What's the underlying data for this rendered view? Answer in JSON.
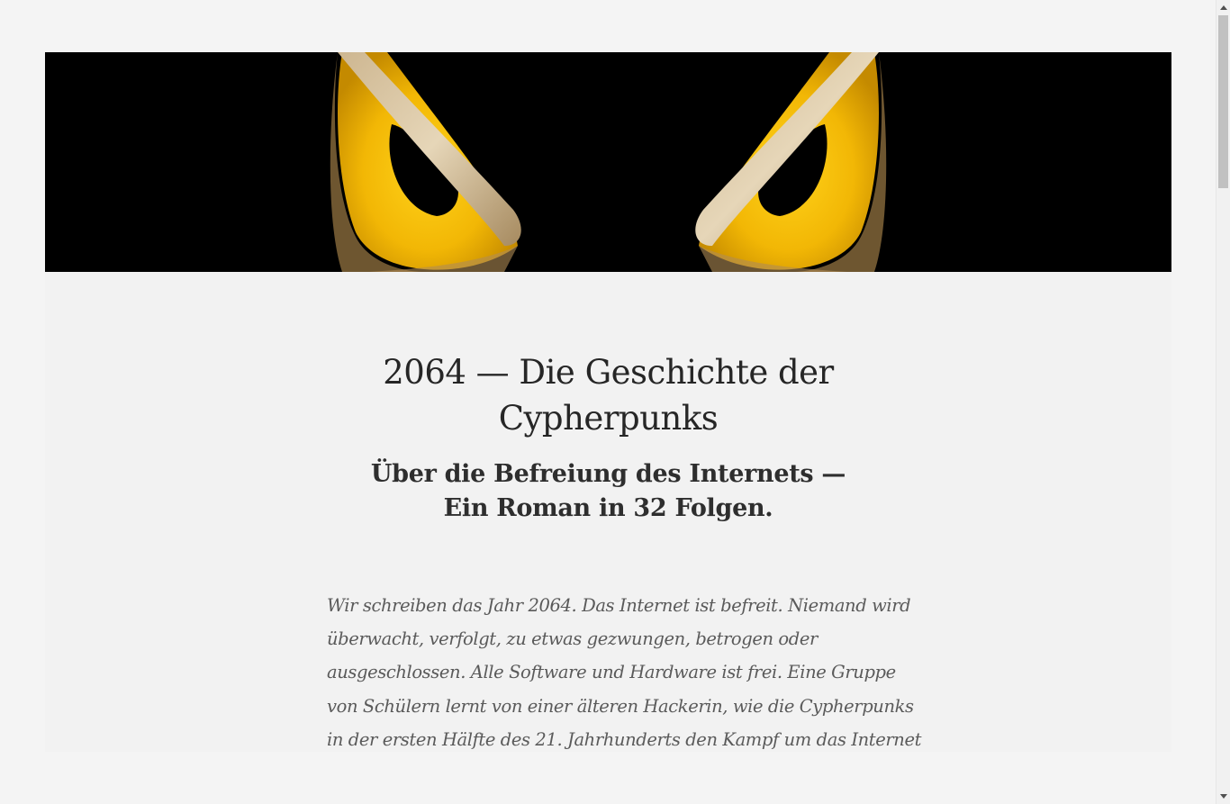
{
  "banner": {
    "image": "owl-eyes-banner",
    "background_color": "#000000",
    "eye_color": "#f2b705"
  },
  "book": {
    "title_lines": [
      "2064 — Die Geschichte der",
      "Cypherpunks"
    ],
    "subtitle_lines": [
      "Über die Befreiung des Internets —",
      "Ein Roman in 32 Folgen."
    ],
    "intro_lines": [
      "Wir schreiben das Jahr 2064. Das Internet ist befreit. Niemand wird",
      "überwacht, verfolgt, zu etwas gezwungen, betrogen oder",
      "ausgeschlossen. Alle Software und Hardware ist frei. Eine Gruppe",
      "von Schülern lernt von einer älteren Hackerin, wie die Cypherpunks",
      "in der ersten Hälfte des 21. Jahrhunderts den Kampf um das Internet"
    ]
  },
  "scrollbar": {
    "up_icon": "triangle-up-icon",
    "down_icon": "triangle-down-icon"
  }
}
